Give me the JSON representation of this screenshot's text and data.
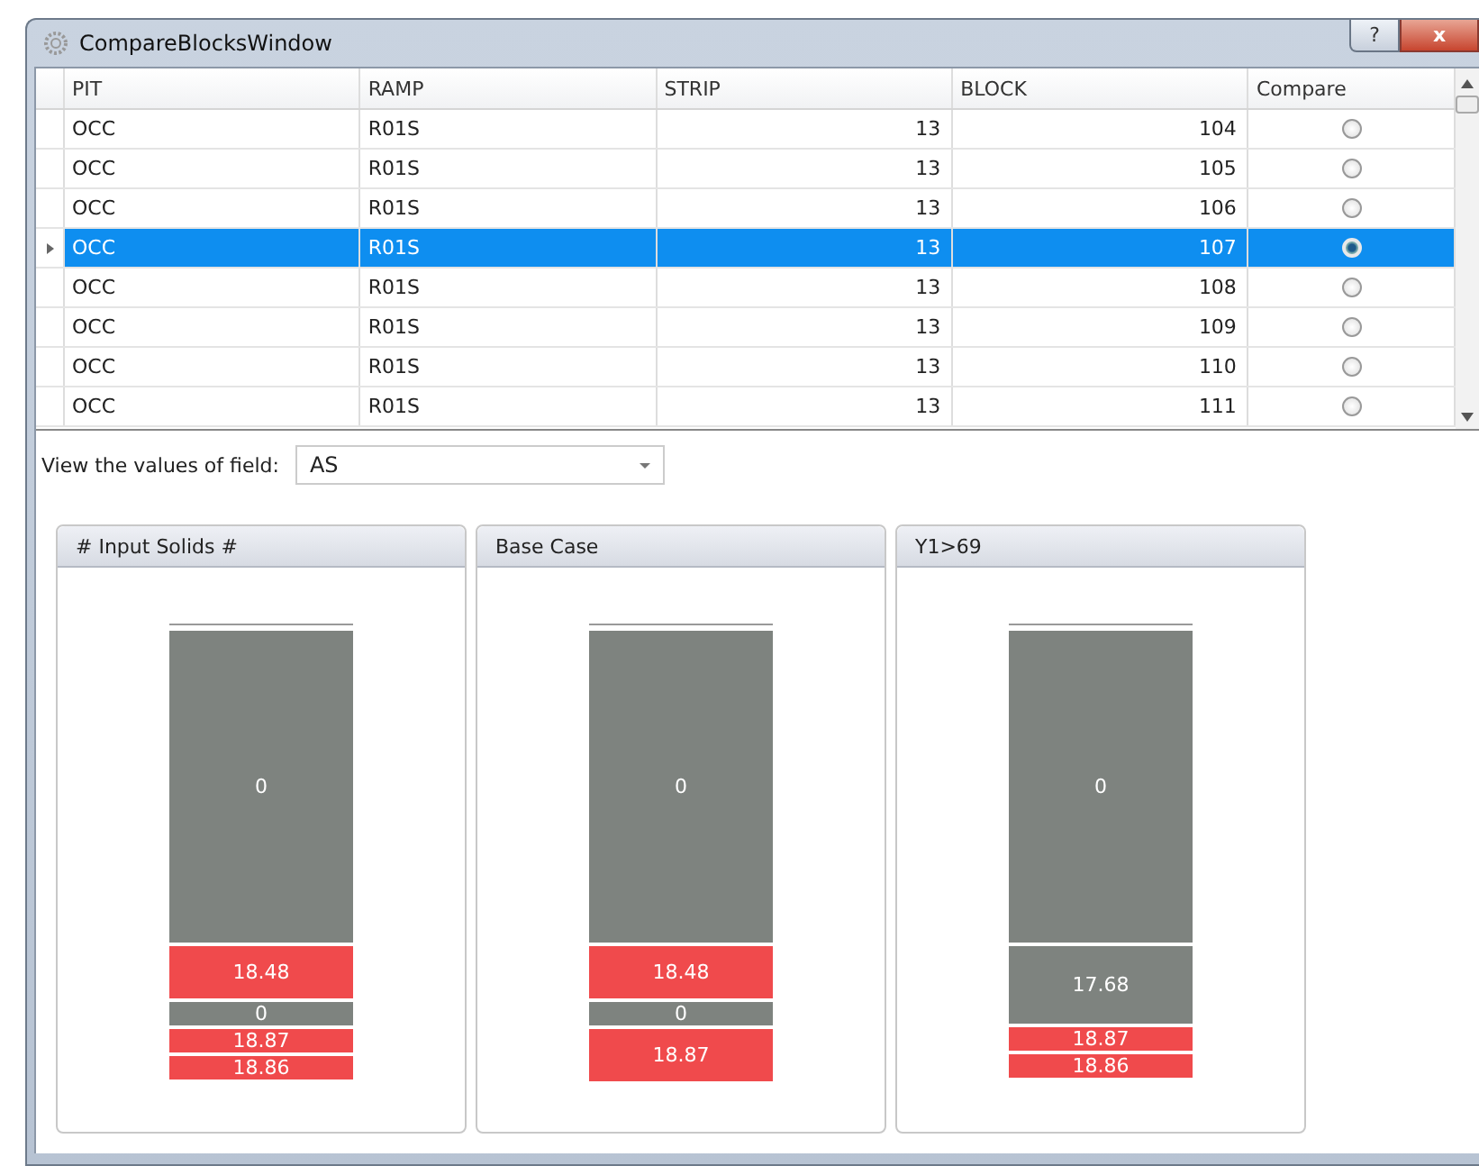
{
  "window": {
    "title": "CompareBlocksWindow",
    "help_button": "?",
    "close_button": "x"
  },
  "table": {
    "columns": [
      "PIT",
      "RAMP",
      "STRIP",
      "BLOCK",
      "Compare"
    ],
    "rows": [
      {
        "pit": "OCC",
        "ramp": "R01S",
        "strip": "13",
        "block": "104",
        "selected": false
      },
      {
        "pit": "OCC",
        "ramp": "R01S",
        "strip": "13",
        "block": "105",
        "selected": false
      },
      {
        "pit": "OCC",
        "ramp": "R01S",
        "strip": "13",
        "block": "106",
        "selected": false
      },
      {
        "pit": "OCC",
        "ramp": "R01S",
        "strip": "13",
        "block": "107",
        "selected": true
      },
      {
        "pit": "OCC",
        "ramp": "R01S",
        "strip": "13",
        "block": "108",
        "selected": false
      },
      {
        "pit": "OCC",
        "ramp": "R01S",
        "strip": "13",
        "block": "109",
        "selected": false
      },
      {
        "pit": "OCC",
        "ramp": "R01S",
        "strip": "13",
        "block": "110",
        "selected": false
      },
      {
        "pit": "OCC",
        "ramp": "R01S",
        "strip": "13",
        "block": "111",
        "selected": false
      }
    ]
  },
  "field_selector": {
    "label": "View the values of field:",
    "value": "AS"
  },
  "panels": [
    {
      "title": "# Input Solids #",
      "segments": [
        {
          "label": "0",
          "color": "#7e837f",
          "kind": "main"
        },
        {
          "label": "18.48",
          "color": "#f04a4c",
          "kind": "wide"
        },
        {
          "label": "0",
          "color": "#7e837f",
          "kind": "thin"
        },
        {
          "label": "18.87",
          "color": "#f04a4c",
          "kind": "thin"
        },
        {
          "label": "18.86",
          "color": "#f04a4c",
          "kind": "thin"
        }
      ]
    },
    {
      "title": "Base Case",
      "segments": [
        {
          "label": "0",
          "color": "#7e837f",
          "kind": "main"
        },
        {
          "label": "18.48",
          "color": "#f04a4c",
          "kind": "wide"
        },
        {
          "label": "0",
          "color": "#7e837f",
          "kind": "thin"
        },
        {
          "label": "18.87",
          "color": "#f04a4c",
          "kind": "wide"
        }
      ]
    },
    {
      "title": "Y1>69",
      "segments": [
        {
          "label": "0",
          "color": "#7e837f",
          "kind": "main"
        },
        {
          "label": "17.68",
          "color": "#7e837f",
          "kind": "tall"
        },
        {
          "label": "18.87",
          "color": "#f04a4c",
          "kind": "thin"
        },
        {
          "label": "18.86",
          "color": "#f04a4c",
          "kind": "thin"
        }
      ]
    }
  ]
}
